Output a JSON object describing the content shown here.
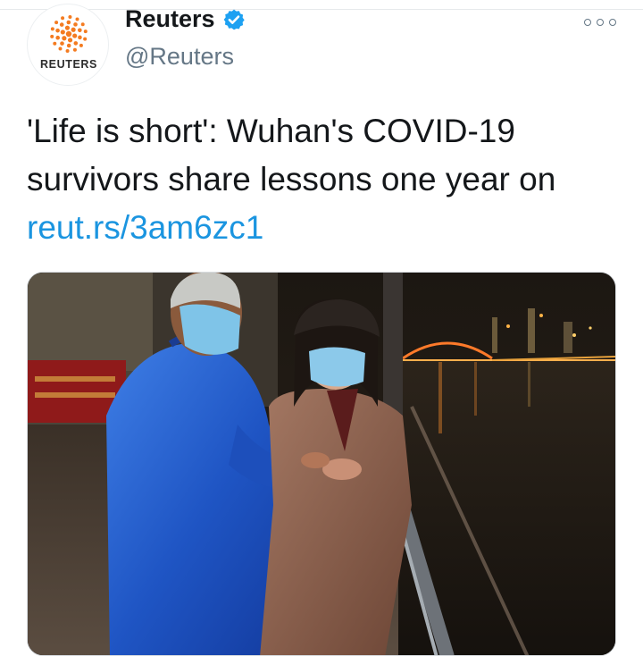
{
  "tweet": {
    "author": {
      "display_name": "Reuters",
      "handle": "@Reuters",
      "verified": true,
      "avatar_wordmark": "REUTERS"
    },
    "text": {
      "body": "'Life is short': Wuhan's COVID-19 survivors share lessons one year on ",
      "link": "reut.rs/3am6zc1"
    },
    "media": {
      "type": "photo"
    }
  },
  "colors": {
    "link": "#1b95e0",
    "verified_badge": "#1da1f2",
    "logo_orange": "#f47b20",
    "secondary_text": "#657786"
  },
  "icons": {
    "verified": "verified-badge-icon",
    "more": "more-options-icon",
    "logo": "reuters-dot-logo"
  }
}
